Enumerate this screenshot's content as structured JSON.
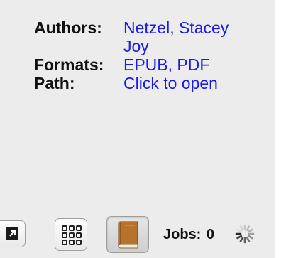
{
  "details": {
    "authors_label": "Authors:",
    "authors_line1": "Netzel, Stacey",
    "authors_line2": "Joy",
    "formats_label": "Formats:",
    "format_1": "EPUB",
    "format_sep": ", ",
    "format_2": "PDF",
    "path_label": "Path:",
    "path_value": "Click to open"
  },
  "toolbar": {
    "jobs_label": "Jobs:",
    "jobs_count": "0",
    "icons": [
      "link-icon",
      "grid-view-icon",
      "book-icon",
      "busy-spinner-icon"
    ]
  },
  "colors": {
    "link": "#1a1ae6",
    "label": "#111111",
    "panel_bg": "#ececec"
  }
}
